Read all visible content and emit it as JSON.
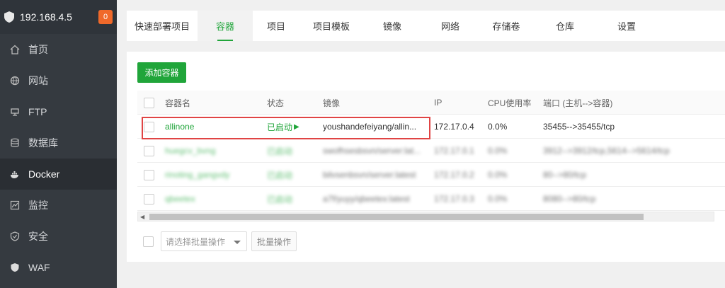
{
  "sidebar": {
    "server_ip": "192.168.4.5",
    "badge_count": "0",
    "items": [
      {
        "label": "首页",
        "icon": "home-icon"
      },
      {
        "label": "网站",
        "icon": "globe-icon"
      },
      {
        "label": "FTP",
        "icon": "ftp-icon"
      },
      {
        "label": "数据库",
        "icon": "database-icon"
      },
      {
        "label": "Docker",
        "icon": "docker-icon"
      },
      {
        "label": "监控",
        "icon": "monitor-icon"
      },
      {
        "label": "安全",
        "icon": "shield-icon"
      },
      {
        "label": "WAF",
        "icon": "waf-shield-icon"
      }
    ],
    "active_item": "Docker"
  },
  "tabs": [
    {
      "label": "快速部署项目"
    },
    {
      "label": "容器"
    },
    {
      "label": "项目"
    },
    {
      "label": "项目模板"
    },
    {
      "label": "镜像"
    },
    {
      "label": "网络"
    },
    {
      "label": "存储卷"
    },
    {
      "label": "仓库"
    },
    {
      "label": "设置"
    }
  ],
  "active_tab": "容器",
  "actions": {
    "add_container": "添加容器",
    "batch_placeholder": "请选择批量操作",
    "batch_button": "批量操作"
  },
  "table": {
    "headers": {
      "name": "容器名",
      "status": "状态",
      "image": "镜像",
      "ip": "IP",
      "cpu": "CPU使用率",
      "port": "端口 (主机-->容器)"
    },
    "rows": [
      {
        "name": "allinone",
        "status": "已启动",
        "image": "youshandefeiyang/allin...",
        "ip": "172.17.0.4",
        "cpu": "0.0%",
        "port": "35455-->35455/tcp",
        "blurred": false
      },
      {
        "name": "huegcv_bvng",
        "status": "已启动",
        "image": "swofhsesbsvn/server:lat...",
        "ip": "172.17.0.1",
        "cpu": "0.0%",
        "port": "3912-->3912/tcp,5614-->5614/tcp",
        "blurred": true
      },
      {
        "name": "rinoting_gangvdy",
        "status": "已启动",
        "image": "bilvsenbsvn/server:latest",
        "ip": "172.17.0.2",
        "cpu": "0.0%",
        "port": "80-->80/tcp",
        "blurred": true
      },
      {
        "name": "qbeetex",
        "status": "已启动",
        "image": "a7f/yuyy/qbeetex:latest",
        "ip": "172.17.0.3",
        "cpu": "0.0%",
        "port": "8080-->80/tcp",
        "blurred": true
      }
    ]
  },
  "colors": {
    "accent": "#20a53a",
    "sidebar_bg": "#353a40",
    "badge": "#f0692a",
    "highlight": "#e04444"
  }
}
